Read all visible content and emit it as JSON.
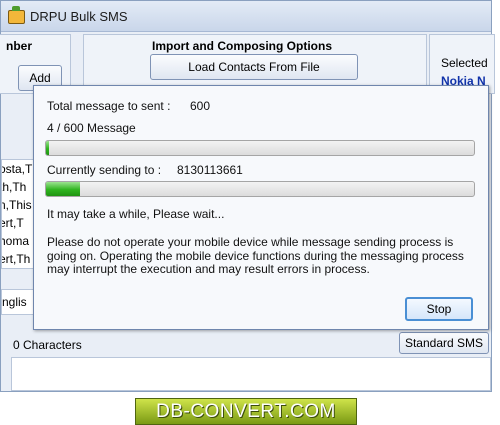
{
  "window": {
    "title": "DRPU Bulk SMS"
  },
  "left_panel": {
    "heading": "nber",
    "add_label": "Add"
  },
  "middle_panel": {
    "heading": "Import and Composing Options",
    "load_contacts_label": "Load Contacts From File"
  },
  "right_panel": {
    "heading": "Selected",
    "device_name": "Nokia N"
  },
  "contacts_list": [
    "osta,T",
    "th,Th",
    "n,This",
    "ert,T",
    "homa",
    "ert,Th"
  ],
  "language_combo": {
    "value": "nglis"
  },
  "message_stats": {
    "characters": "0 Characters",
    "sms_type_label": "Standard SMS"
  },
  "progress_dialog": {
    "total_label": "Total message to sent :",
    "total_value": "600",
    "progress_text": "4 / 600 Message",
    "overall_progress": 0.0067,
    "sending_label": "Currently sending to :",
    "sending_number": "8130113661",
    "current_progress": 0.08,
    "wait_text": "It may take a while, Please wait...",
    "warning_text": "Please do not operate your mobile device while message sending process is going on. Operating the mobile device functions during the messaging process may interrupt the execution and may result errors in process.",
    "stop_label": "Stop"
  },
  "brand": {
    "logo_text": "DB-CONVERT.COM"
  },
  "colors": {
    "progress_green": "#2fb41f",
    "device_name_blue": "#1133aa",
    "stop_border": "#4a8fd4"
  }
}
